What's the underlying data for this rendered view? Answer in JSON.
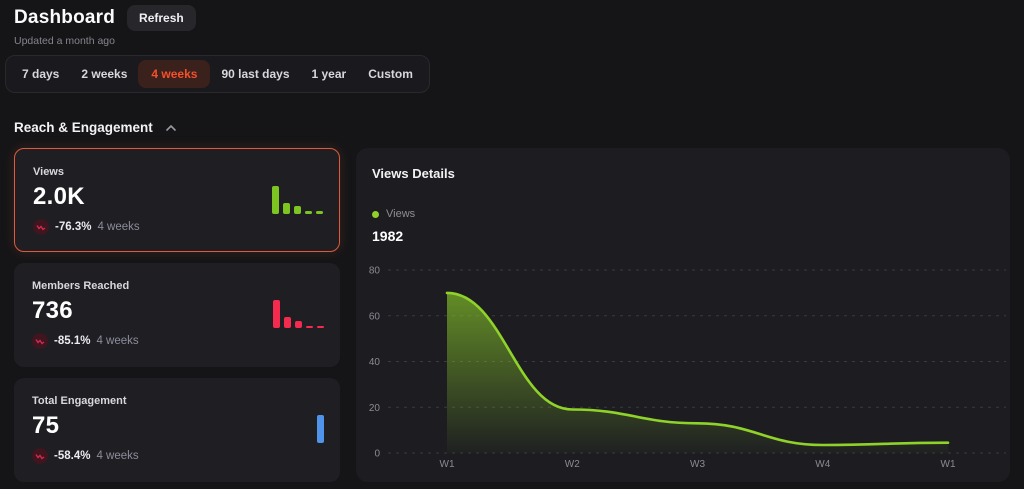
{
  "header": {
    "title": "Dashboard",
    "refresh_label": "Refresh",
    "updated_text": "Updated a month ago"
  },
  "tabs": {
    "items": [
      "7 days",
      "2 weeks",
      "4 weeks",
      "90 last days",
      "1 year",
      "Custom"
    ],
    "active": "4 weeks"
  },
  "section": {
    "title": "Reach & Engagement"
  },
  "cards": [
    {
      "label": "Views",
      "value": "2.0K",
      "change": "-76.3%",
      "period": "4 weeks",
      "color": "#7dc521",
      "spark": [
        100,
        40,
        27,
        10,
        10
      ],
      "highlighted": true
    },
    {
      "label": "Members Reached",
      "value": "736",
      "change": "-85.1%",
      "period": "4 weeks",
      "color": "#f42a4e",
      "spark": [
        100,
        38,
        25,
        9,
        9
      ],
      "highlighted": false
    },
    {
      "label": "Total Engagement",
      "value": "75",
      "change": "-58.4%",
      "period": "4 weeks",
      "color": "#4f94ea",
      "spark": [
        100
      ],
      "highlighted": false
    }
  ],
  "chart_data": {
    "type": "area",
    "panel_title": "Views Details",
    "legend": "Views",
    "current_value": "1982",
    "categories": [
      "W1",
      "W2",
      "W3",
      "W4",
      "W1"
    ],
    "series": [
      {
        "name": "Views",
        "values": [
          70,
          19,
          13,
          3.5,
          4.5
        ]
      }
    ],
    "ylim": [
      0,
      80
    ],
    "yticks": [
      0,
      20,
      40,
      60,
      80
    ],
    "line_color": "#8fd32a",
    "fill": "vertical green gradient fading to transparent",
    "grid": "horizontal dashed",
    "legend_position": "top-left"
  },
  "colors": {
    "active_tab_text": "#f4502c",
    "active_tab_bg": "#3b211b",
    "highlight_border": "#dd5b3c",
    "negative_icon_bg": "#3f151f",
    "negative_icon_stroke": "#cf2b4e"
  }
}
